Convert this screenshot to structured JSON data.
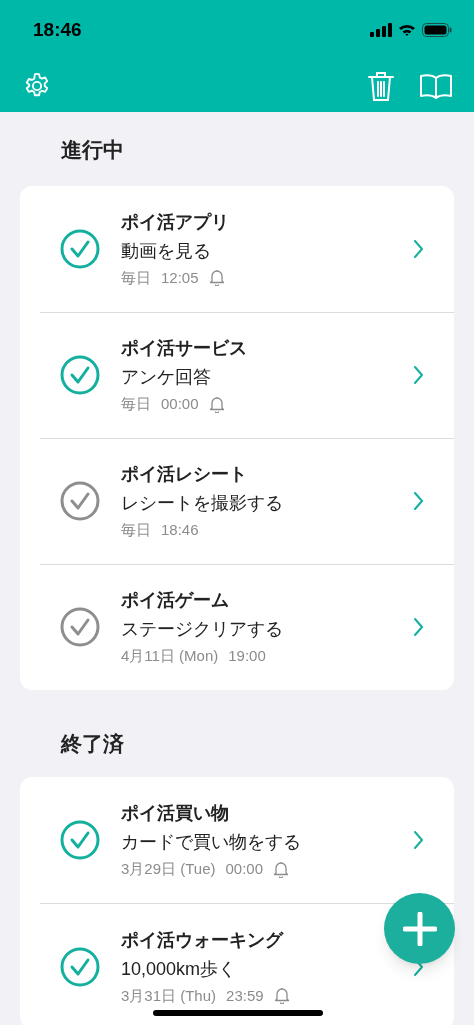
{
  "status_bar": {
    "time": "18:46"
  },
  "sections": [
    {
      "title": "進行中",
      "items": [
        {
          "title": "ポイ活アプリ",
          "subtitle": "動画を見る",
          "date": "毎日",
          "time": "12:05",
          "reminder": true,
          "checked": true
        },
        {
          "title": "ポイ活サービス",
          "subtitle": "アンケ回答",
          "date": "毎日",
          "time": "00:00",
          "reminder": true,
          "checked": true
        },
        {
          "title": "ポイ活レシート",
          "subtitle": "レシートを撮影する",
          "date": "毎日",
          "time": "18:46",
          "reminder": false,
          "checked": false
        },
        {
          "title": "ポイ活ゲーム",
          "subtitle": "ステージクリアする",
          "date": "4月11日 (Mon)",
          "time": "19:00",
          "reminder": false,
          "checked": false
        }
      ]
    },
    {
      "title": "終了済",
      "items": [
        {
          "title": "ポイ活買い物",
          "subtitle": "カードで買い物をする",
          "date": "3月29日 (Tue)",
          "time": "00:00",
          "reminder": true,
          "checked": true
        },
        {
          "title": "ポイ活ウォーキング",
          "subtitle": "10,000km歩く",
          "date": "3月31日 (Thu)",
          "time": "23:59",
          "reminder": true,
          "checked": true
        }
      ]
    }
  ]
}
